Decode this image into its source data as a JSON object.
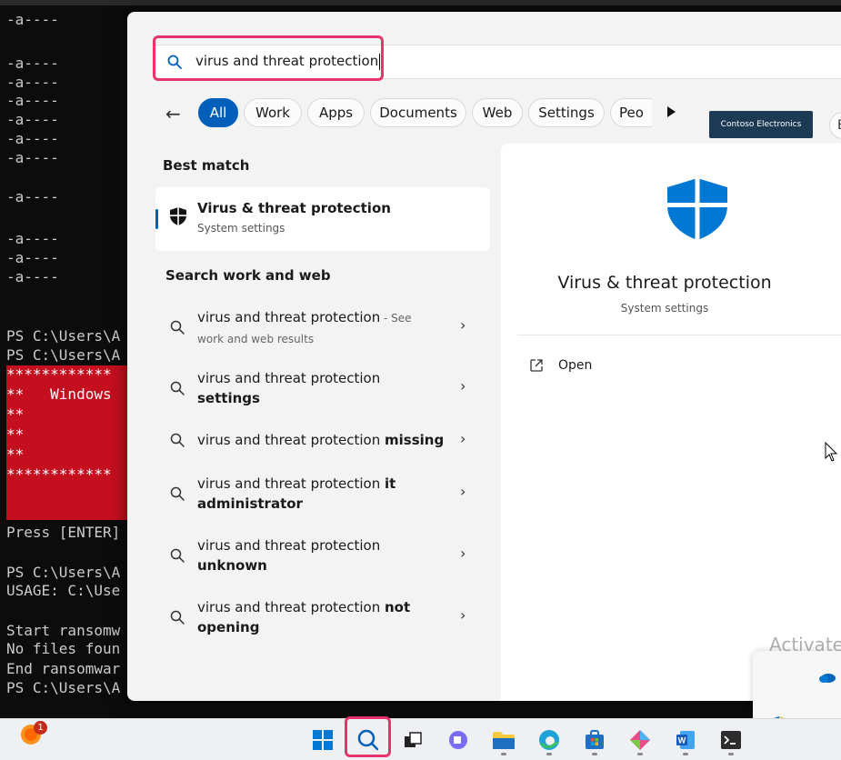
{
  "terminal": {
    "lines": [
      "-a----",
      "-a----",
      "-a----",
      "-a----",
      "-a----",
      "-a----",
      "-a----",
      "-a----",
      "-a----",
      "-a----",
      "-a----"
    ],
    "ps1": "PS C:\\Users\\A",
    "ps2": "PS C:\\Users\\A",
    "red_stars1": "************",
    "red_windows": "**   Windows",
    "red_s1": "**",
    "red_s2": "**",
    "red_s3": "**",
    "red_stars2": "************",
    "press_enter": "Press [ENTER]",
    "ps3": "PS C:\\Users\\A",
    "usage": "USAGE: C:\\Use",
    "start": "Start ransomw",
    "nofiles": "No files foun",
    "end": "End ransomwar",
    "ps4": "PS C:\\Users\\A"
  },
  "search": {
    "query": "virus and threat protection"
  },
  "filters": {
    "all": "All",
    "work": "Work",
    "apps": "Apps",
    "documents": "Documents",
    "web": "Web",
    "settings": "Settings",
    "people": "Peo",
    "contoso": "Contoso Electronics",
    "e": "E"
  },
  "best_match": {
    "heading": "Best match",
    "title": "Virus & threat protection",
    "subtitle": "System settings"
  },
  "web_section": {
    "heading": "Search work and web",
    "results": [
      {
        "base": "virus and threat protection",
        "suffix": " - See",
        "extra": "work and web results"
      },
      {
        "base": "virus and threat protection",
        "bold": "settings"
      },
      {
        "base": "virus and threat protection",
        "bold": "missing"
      },
      {
        "base": "virus and threat protection",
        "bold_inline": "it",
        "bold": "administrator"
      },
      {
        "base": "virus and threat protection",
        "bold": "unknown"
      },
      {
        "base": "virus and threat protection",
        "bold_inline": "not",
        "bold": "opening"
      }
    ]
  },
  "preview": {
    "title": "Virus & threat protection",
    "subtitle": "System settings",
    "open_label": "Open"
  },
  "overlay": {
    "activate": "Activate"
  },
  "taskbar": {
    "badge_count": "1"
  }
}
